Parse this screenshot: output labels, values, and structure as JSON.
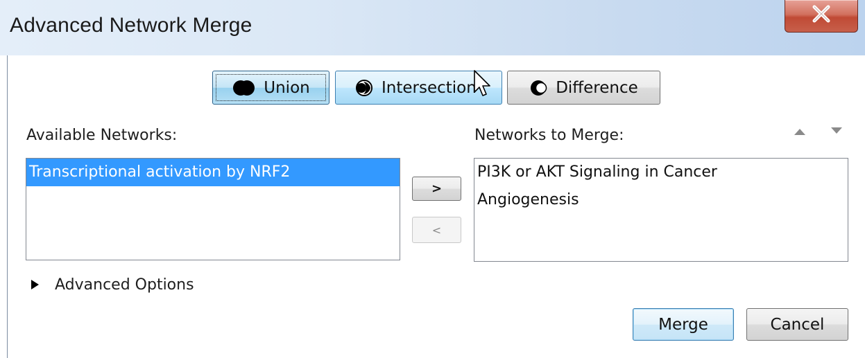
{
  "window": {
    "title": "Advanced Network Merge"
  },
  "operations": [
    {
      "label": "Union",
      "state": "selected"
    },
    {
      "label": "Intersection",
      "state": "hover"
    },
    {
      "label": "Difference",
      "state": "normal"
    }
  ],
  "available": {
    "label": "Available Networks:",
    "items": [
      "Transcriptional activation by NRF2"
    ],
    "selected_index": 0
  },
  "transfer": {
    "add_label": ">",
    "remove_label": "<"
  },
  "to_merge": {
    "label": "Networks to Merge:",
    "items": [
      "PI3K or AKT Signaling in Cancer",
      "Angiogenesis"
    ]
  },
  "advanced_options": {
    "label": "Advanced Options",
    "expanded": false
  },
  "actions": {
    "merge_label": "Merge",
    "cancel_label": "Cancel"
  },
  "colors": {
    "selection": "#3399ff",
    "close_button": "#c7604b",
    "title_bar": "#dbe8f6"
  }
}
